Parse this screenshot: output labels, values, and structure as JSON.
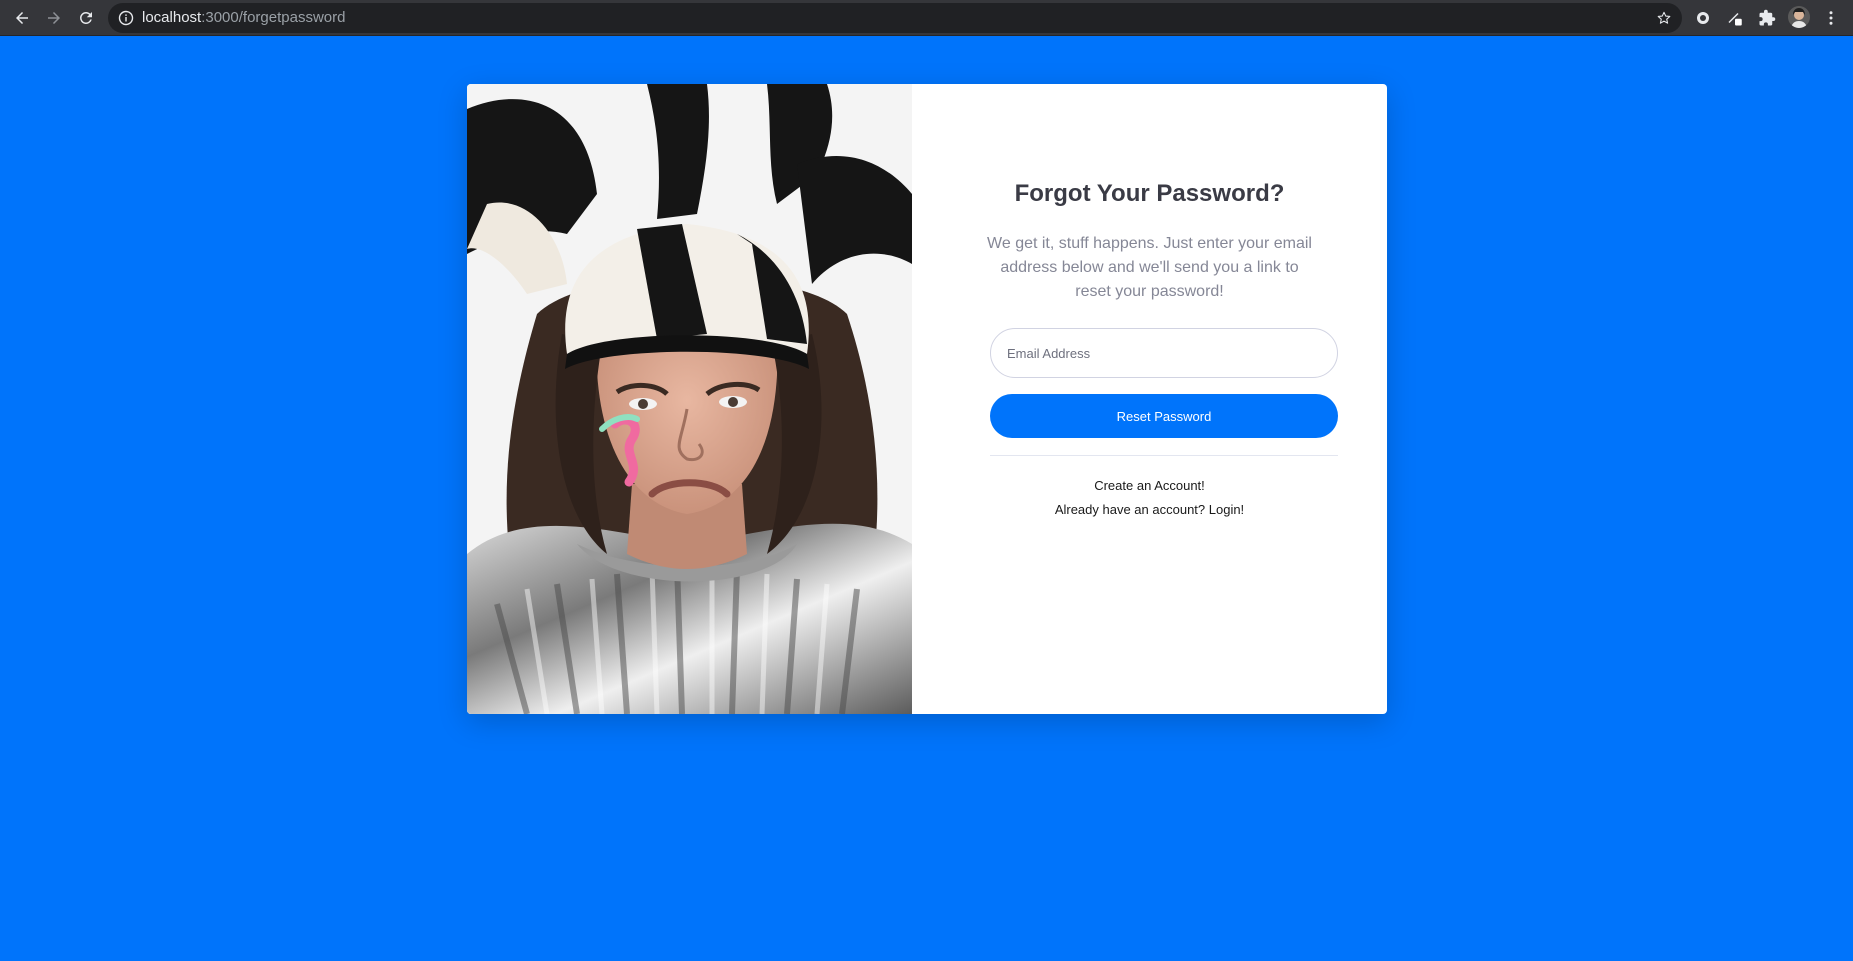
{
  "browser": {
    "url_host": "localhost",
    "url_path": ":3000/forgetpassword"
  },
  "form": {
    "title": "Forgot Your Password?",
    "subtitle": "We get it, stuff happens. Just enter your email address below and we'll send you a link to reset your password!",
    "email_placeholder": "Email Address",
    "email_value": "",
    "reset_button_label": "Reset Password",
    "create_account_link": "Create an Account!",
    "login_link": "Already have an account? Login!"
  },
  "colors": {
    "page_background": "#0074fb",
    "primary_button": "#0074fb",
    "title_text": "#3a3b45",
    "muted_text": "#858796"
  },
  "icons": {
    "back": "arrow-left-icon",
    "forward": "arrow-right-icon",
    "reload": "reload-icon",
    "site_info": "info-icon",
    "bookmark": "star-icon",
    "extensions": "puzzle-icon",
    "menu": "kebab-menu-icon"
  }
}
